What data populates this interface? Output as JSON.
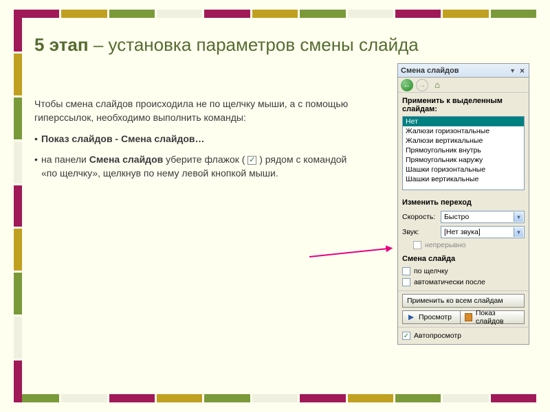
{
  "heading_bold": "5 этап",
  "heading_rest": " – установка параметров смены слайда",
  "body": {
    "p1": "Чтобы смена слайдов происходила не по щелчку мыши, а с помощью гиперссылок, необходимо выполнить команды:",
    "p2": "Показ слайдов - Смена слайдов…",
    "p3a": "на панели ",
    "p3b": "Смена слайдов",
    "p3c": " уберите флажок (",
    "p3d": ") рядом с командой «по щелчку», щелкнув по нему левой кнопкой мыши.",
    "check_mark": "✓"
  },
  "panel": {
    "title": "Смена слайдов",
    "section_apply": "Применить к выделенным слайдам:",
    "transitions": [
      "Нет",
      "Жалюзи горизонтальные",
      "Жалюзи вертикальные",
      "Прямоугольник внутрь",
      "Прямоугольник наружу",
      "Шашки горизонтальные",
      "Шашки вертикальные"
    ],
    "section_modify": "Изменить переход",
    "speed_label": "Скорость:",
    "speed_value": "Быстро",
    "sound_label": "Звук:",
    "sound_value": "[Нет звука]",
    "loop_label": "непрерывно",
    "section_advance": "Смена слайда",
    "on_click": "по щелчку",
    "auto_after": "автоматически после",
    "apply_all": "Применить ко всем слайдам",
    "preview": "Просмотр",
    "slideshow": "Показ слайдов",
    "autopreview": "Автопросмотр"
  }
}
